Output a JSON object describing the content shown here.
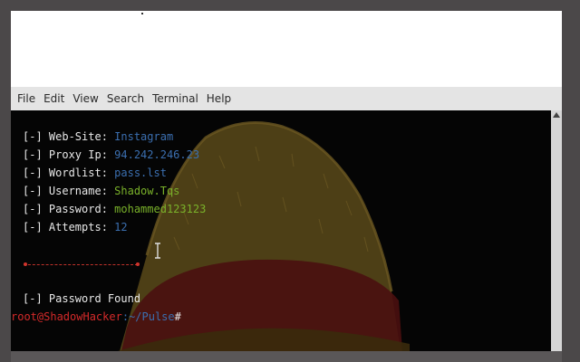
{
  "menu": {
    "items": [
      "File",
      "Edit",
      "View",
      "Search",
      "Terminal",
      "Help"
    ]
  },
  "terminal": {
    "lines": [
      {
        "prefix": "[-] ",
        "key": "Web-Site: ",
        "value": "Instagram",
        "color": "#3b6fb0"
      },
      {
        "prefix": "[-] ",
        "key": "Proxy Ip: ",
        "value": "94.242.246.23",
        "color": "#3b6fb0"
      },
      {
        "prefix": "[-] ",
        "key": "Wordlist: ",
        "value": "pass.lst",
        "color": "#3b6fb0"
      },
      {
        "prefix": "[-] ",
        "key": "Username: ",
        "value": "Shadow.Tqs",
        "color": "#7ab22a"
      },
      {
        "prefix": "[-] ",
        "key": "Password: ",
        "value": "mohammed123123",
        "color": "#7ab22a"
      },
      {
        "prefix": "[-] ",
        "key": "Attempts: ",
        "value": "12",
        "color": "#3b6fb0"
      }
    ],
    "found": "[-] Password Found",
    "prompt": {
      "user_host": "root@ShadowHacker",
      "path": ":~/Pulse",
      "symbol": "#"
    }
  },
  "colors": {
    "terminal_bg": "#050505",
    "menubar_bg": "#e4e4e4",
    "accent_blue": "#3b6fb0",
    "accent_green": "#7ab22a",
    "prompt_red": "#d52a2a"
  },
  "icons": {
    "scroll_up": "triangle-up",
    "text_cursor": "i-beam"
  }
}
